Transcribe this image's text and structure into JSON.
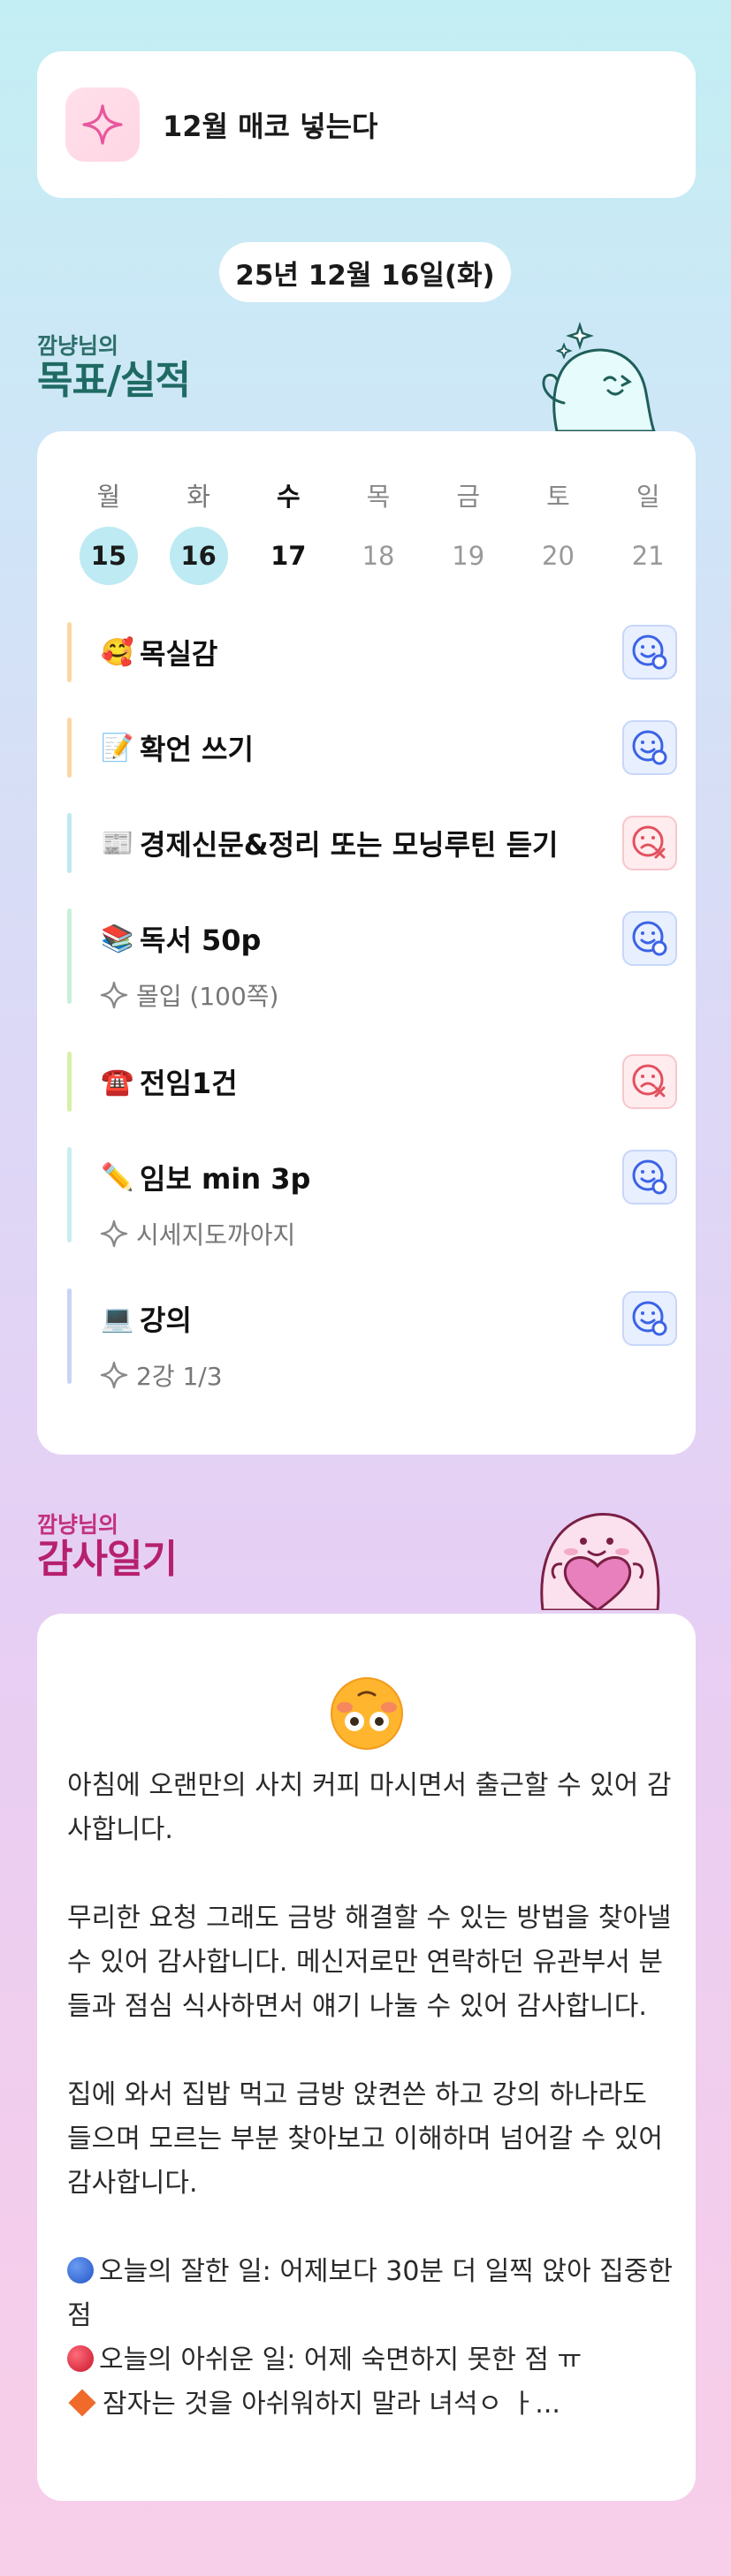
{
  "goal": {
    "icon": "sparkle-icon",
    "text": "12월 매코 넣는다"
  },
  "date": "25년 12월 16일(화)",
  "goals_section": {
    "owner": "깜냥님의",
    "title": "목표/실적"
  },
  "week": [
    {
      "name": "월",
      "num": "15",
      "state": "past"
    },
    {
      "name": "화",
      "num": "16",
      "state": "past"
    },
    {
      "name": "수",
      "num": "17",
      "state": "today"
    },
    {
      "name": "목",
      "num": "18",
      "state": "future"
    },
    {
      "name": "금",
      "num": "19",
      "state": "future"
    },
    {
      "name": "토",
      "num": "20",
      "state": "future"
    },
    {
      "name": "일",
      "num": "21",
      "state": "future"
    }
  ],
  "tasks": [
    {
      "emoji": "🥰",
      "label": "목실감",
      "sub": "",
      "status": "done",
      "bar_color": "#fbd7a5"
    },
    {
      "emoji": "📝",
      "label": "확언 쓰기",
      "sub": "",
      "status": "done",
      "bar_color": "#fbd7a5"
    },
    {
      "emoji": "📰",
      "label": "경제신문&정리 또는 모닝루틴 듣기",
      "sub": "",
      "status": "fail",
      "bar_color": "#bfe9ef"
    },
    {
      "emoji": "📚",
      "label": "독서 50p",
      "sub": "몰입 (100쪽)",
      "status": "done",
      "bar_color": "#c8f0d9"
    },
    {
      "emoji": "☎️",
      "label": "전임1건",
      "sub": "",
      "status": "fail",
      "bar_color": "#d8efa9"
    },
    {
      "emoji": "✏️",
      "label": "임보 min 3p",
      "sub": "시세지도까아지",
      "status": "done",
      "bar_color": "#c8eef0"
    },
    {
      "emoji": "💻",
      "label": "강의",
      "sub": "2강 1/3",
      "status": "done",
      "bar_color": "#c9d4f4"
    }
  ],
  "thanks_section": {
    "owner": "깜냥님의",
    "title": "감사일기"
  },
  "diary": {
    "mood_icon": "upside-down-flushed-face-icon",
    "paragraphs": [
      "아침에 오랜만의 사치 커피 마시면서 출근할 수 있어 감사합니다.",
      "무리한 요청 그래도 금방 해결할 수 있는 방법을 찾아낼 수 있어 감사합니다. 메신저로만 연락하던 유관부서 분들과 점심 식사하면서 얘기 나눌 수 있어 감사합니다.",
      "집에 와서 집밥 먹고 금방 앉켠쓴 하고 강의 하나라도 들으며 모르는 부분 찾아보고 이해하며 넘어갈 수 있어 감사합니다."
    ],
    "good": "오늘의 잘한 일: 어제보다 30분 더 일찍 앉아 집중한 점",
    "bad": "오늘의 아쉬운 일: 어제 숙면하지 못한  점 ㅠ",
    "note": "잠자는 것을 아쉬워하지 말라 녀석ㅇ ㅏ..."
  },
  "colors": {
    "done": "#3b63e6",
    "fail": "#e2515f",
    "accent_pink": "#e8579c",
    "teal": "#1f6b64"
  }
}
